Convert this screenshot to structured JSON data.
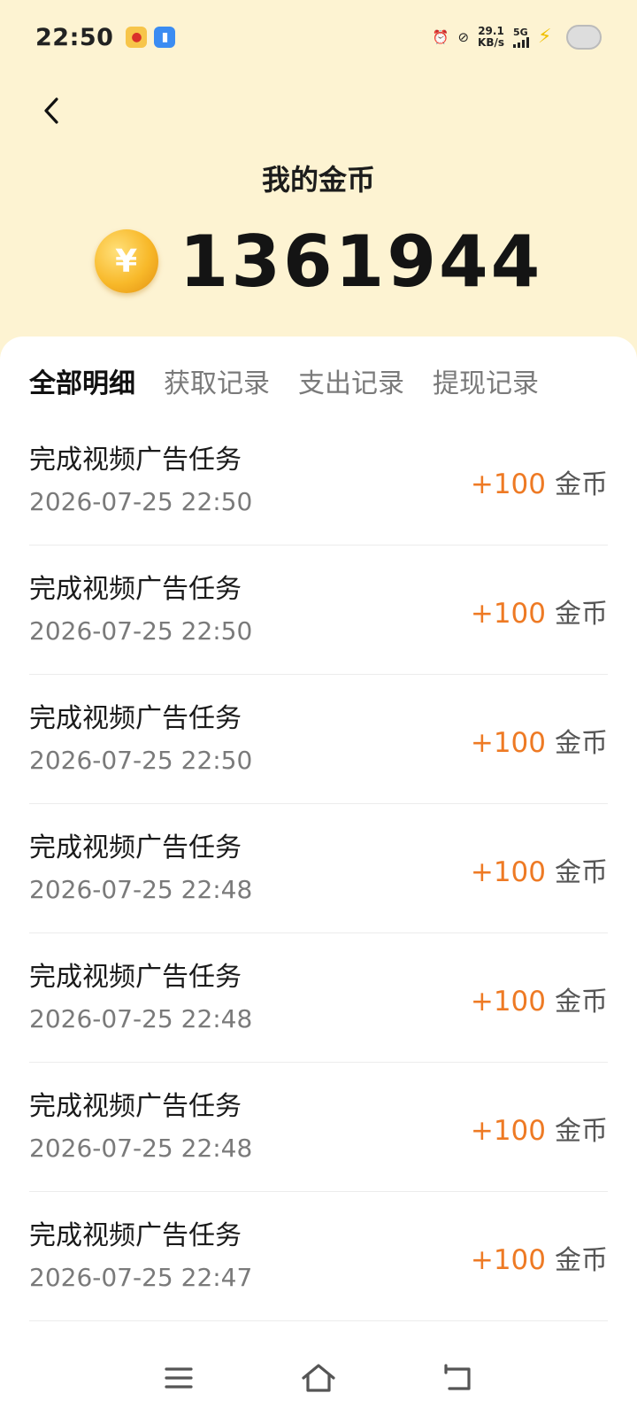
{
  "status_bar": {
    "time": "22:50",
    "net_speed_value": "29.1",
    "net_speed_unit": "KB/s",
    "network": "5G",
    "icons": [
      "weibo-icon",
      "document-icon",
      "alarm-icon",
      "eye-off-icon",
      "signal-icon",
      "charging-icon",
      "battery-icon"
    ]
  },
  "header": {
    "title": "我的金币",
    "balance": "1361944",
    "coin_symbol": "¥"
  },
  "tabs": [
    {
      "label": "全部明细",
      "active": true
    },
    {
      "label": "获取记录",
      "active": false
    },
    {
      "label": "支出记录",
      "active": false
    },
    {
      "label": "提现记录",
      "active": false
    }
  ],
  "records": [
    {
      "title": "完成视频广告任务",
      "time": "2026-07-25 22:50",
      "amount": "+100",
      "unit": "金币"
    },
    {
      "title": "完成视频广告任务",
      "time": "2026-07-25 22:50",
      "amount": "+100",
      "unit": "金币"
    },
    {
      "title": "完成视频广告任务",
      "time": "2026-07-25 22:50",
      "amount": "+100",
      "unit": "金币"
    },
    {
      "title": "完成视频广告任务",
      "time": "2026-07-25 22:48",
      "amount": "+100",
      "unit": "金币"
    },
    {
      "title": "完成视频广告任务",
      "time": "2026-07-25 22:48",
      "amount": "+100",
      "unit": "金币"
    },
    {
      "title": "完成视频广告任务",
      "time": "2026-07-25 22:48",
      "amount": "+100",
      "unit": "金币"
    },
    {
      "title": "完成视频广告任务",
      "time": "2026-07-25 22:47",
      "amount": "+100",
      "unit": "金币"
    }
  ],
  "colors": {
    "header_bg": "#fdf3d2",
    "accent_amount": "#ee7a24",
    "coin": "#f8b92a"
  }
}
